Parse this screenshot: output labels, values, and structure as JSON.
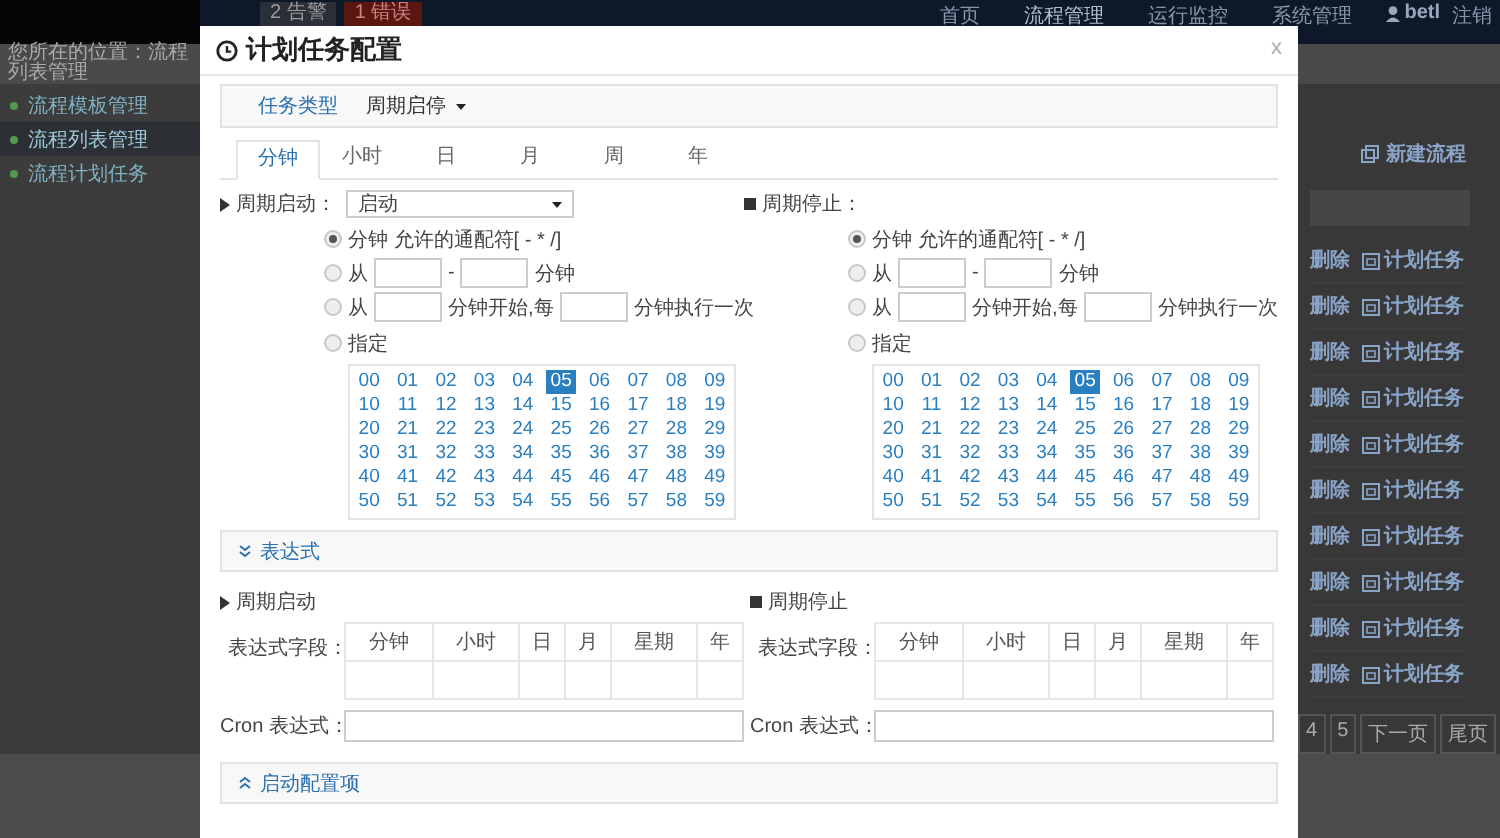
{
  "background": {
    "alerts": [
      {
        "label": "2 告警",
        "kind": "warning"
      },
      {
        "label": "1 错误",
        "kind": "error"
      }
    ],
    "nav": [
      {
        "label": "首页",
        "selected": false
      },
      {
        "label": "流程管理",
        "selected": true
      },
      {
        "label": "运行监控",
        "selected": false
      },
      {
        "label": "系统管理",
        "selected": false
      }
    ],
    "user": "betl",
    "logout": "注销",
    "breadcrumb": "您所在的位置：流程列表管理",
    "sidebar": [
      {
        "label": "流程模板管理",
        "selected": false
      },
      {
        "label": "流程列表管理",
        "selected": true
      },
      {
        "label": "流程计划任务",
        "selected": false
      }
    ],
    "new_button": "新建流程",
    "rows": [
      {
        "delete": "删除",
        "schedule": "计划任务"
      },
      {
        "delete": "删除",
        "schedule": "计划任务"
      },
      {
        "delete": "删除",
        "schedule": "计划任务"
      },
      {
        "delete": "删除",
        "schedule": "计划任务"
      },
      {
        "delete": "删除",
        "schedule": "计划任务"
      },
      {
        "delete": "删除",
        "schedule": "计划任务"
      },
      {
        "delete": "删除",
        "schedule": "计划任务"
      },
      {
        "delete": "删除",
        "schedule": "计划任务"
      },
      {
        "delete": "删除",
        "schedule": "计划任务"
      },
      {
        "delete": "删除",
        "schedule": "计划任务"
      }
    ],
    "pagination": [
      "4",
      "5",
      "下一页",
      "尾页"
    ]
  },
  "dialog": {
    "title": "计划任务配置",
    "close": "x",
    "task_type": {
      "label": "任务类型",
      "value": "周期启停"
    },
    "tabs": [
      {
        "label": "分钟",
        "selected": true
      },
      {
        "label": "小时",
        "selected": false
      },
      {
        "label": "日",
        "selected": false
      },
      {
        "label": "月",
        "selected": false
      },
      {
        "label": "周",
        "selected": false
      },
      {
        "label": "年",
        "selected": false
      }
    ],
    "start": {
      "kind": "start",
      "label": "周期启动：",
      "mode": "启动",
      "options": [
        {
          "kind": "wildcard",
          "selected": true,
          "text": "分钟 允许的通配符[ - * /]"
        },
        {
          "kind": "range",
          "selected": false,
          "from": "从",
          "dash": "-",
          "unit": "分钟"
        },
        {
          "kind": "step",
          "selected": false,
          "from": "从",
          "middle": "分钟开始,每",
          "unit": "分钟执行一次"
        },
        {
          "kind": "specify",
          "selected": false,
          "text": "指定",
          "minutes": [
            {
              "value": "00",
              "selected": false
            },
            {
              "value": "01",
              "selected": false
            },
            {
              "value": "02",
              "selected": false
            },
            {
              "value": "03",
              "selected": false
            },
            {
              "value": "04",
              "selected": false
            },
            {
              "value": "05",
              "selected": true
            },
            {
              "value": "06",
              "selected": false
            },
            {
              "value": "07",
              "selected": false
            },
            {
              "value": "08",
              "selected": false
            },
            {
              "value": "09",
              "selected": false
            },
            {
              "value": "10",
              "selected": false
            },
            {
              "value": "11",
              "selected": false
            },
            {
              "value": "12",
              "selected": false
            },
            {
              "value": "13",
              "selected": false
            },
            {
              "value": "14",
              "selected": false
            },
            {
              "value": "15",
              "selected": false
            },
            {
              "value": "16",
              "selected": false
            },
            {
              "value": "17",
              "selected": false
            },
            {
              "value": "18",
              "selected": false
            },
            {
              "value": "19",
              "selected": false
            },
            {
              "value": "20",
              "selected": false
            },
            {
              "value": "21",
              "selected": false
            },
            {
              "value": "22",
              "selected": false
            },
            {
              "value": "23",
              "selected": false
            },
            {
              "value": "24",
              "selected": false
            },
            {
              "value": "25",
              "selected": false
            },
            {
              "value": "26",
              "selected": false
            },
            {
              "value": "27",
              "selected": false
            },
            {
              "value": "28",
              "selected": false
            },
            {
              "value": "29",
              "selected": false
            },
            {
              "value": "30",
              "selected": false
            },
            {
              "value": "31",
              "selected": false
            },
            {
              "value": "32",
              "selected": false
            },
            {
              "value": "33",
              "selected": false
            },
            {
              "value": "34",
              "selected": false
            },
            {
              "value": "35",
              "selected": false
            },
            {
              "value": "36",
              "selected": false
            },
            {
              "value": "37",
              "selected": false
            },
            {
              "value": "38",
              "selected": false
            },
            {
              "value": "39",
              "selected": false
            },
            {
              "value": "40",
              "selected": false
            },
            {
              "value": "41",
              "selected": false
            },
            {
              "value": "42",
              "selected": false
            },
            {
              "value": "43",
              "selected": false
            },
            {
              "value": "44",
              "selected": false
            },
            {
              "value": "45",
              "selected": false
            },
            {
              "value": "46",
              "selected": false
            },
            {
              "value": "47",
              "selected": false
            },
            {
              "value": "48",
              "selected": false
            },
            {
              "value": "49",
              "selected": false
            },
            {
              "value": "50",
              "selected": false
            },
            {
              "value": "51",
              "selected": false
            },
            {
              "value": "52",
              "selected": false
            },
            {
              "value": "53",
              "selected": false
            },
            {
              "value": "54",
              "selected": false
            },
            {
              "value": "55",
              "selected": false
            },
            {
              "value": "56",
              "selected": false
            },
            {
              "value": "57",
              "selected": false
            },
            {
              "value": "58",
              "selected": false
            },
            {
              "value": "59",
              "selected": false
            }
          ]
        }
      ]
    },
    "stop": {
      "kind": "stop",
      "label": "周期停止：",
      "options": [
        {
          "kind": "wildcard",
          "selected": true,
          "text": "分钟 允许的通配符[ - * /]"
        },
        {
          "kind": "range",
          "selected": false,
          "from": "从",
          "dash": "-",
          "unit": "分钟"
        },
        {
          "kind": "step",
          "selected": false,
          "from": "从",
          "middle": "分钟开始,每",
          "unit": "分钟执行一次"
        },
        {
          "kind": "specify",
          "selected": false,
          "text": "指定",
          "minutes": [
            {
              "value": "00",
              "selected": false
            },
            {
              "value": "01",
              "selected": false
            },
            {
              "value": "02",
              "selected": false
            },
            {
              "value": "03",
              "selected": false
            },
            {
              "value": "04",
              "selected": false
            },
            {
              "value": "05",
              "selected": true
            },
            {
              "value": "06",
              "selected": false
            },
            {
              "value": "07",
              "selected": false
            },
            {
              "value": "08",
              "selected": false
            },
            {
              "value": "09",
              "selected": false
            },
            {
              "value": "10",
              "selected": false
            },
            {
              "value": "11",
              "selected": false
            },
            {
              "value": "12",
              "selected": false
            },
            {
              "value": "13",
              "selected": false
            },
            {
              "value": "14",
              "selected": false
            },
            {
              "value": "15",
              "selected": false
            },
            {
              "value": "16",
              "selected": false
            },
            {
              "value": "17",
              "selected": false
            },
            {
              "value": "18",
              "selected": false
            },
            {
              "value": "19",
              "selected": false
            },
            {
              "value": "20",
              "selected": false
            },
            {
              "value": "21",
              "selected": false
            },
            {
              "value": "22",
              "selected": false
            },
            {
              "value": "23",
              "selected": false
            },
            {
              "value": "24",
              "selected": false
            },
            {
              "value": "25",
              "selected": false
            },
            {
              "value": "26",
              "selected": false
            },
            {
              "value": "27",
              "selected": false
            },
            {
              "value": "28",
              "selected": false
            },
            {
              "value": "29",
              "selected": false
            },
            {
              "value": "30",
              "selected": false
            },
            {
              "value": "31",
              "selected": false
            },
            {
              "value": "32",
              "selected": false
            },
            {
              "value": "33",
              "selected": false
            },
            {
              "value": "34",
              "selected": false
            },
            {
              "value": "35",
              "selected": false
            },
            {
              "value": "36",
              "selected": false
            },
            {
              "value": "37",
              "selected": false
            },
            {
              "value": "38",
              "selected": false
            },
            {
              "value": "39",
              "selected": false
            },
            {
              "value": "40",
              "selected": false
            },
            {
              "value": "41",
              "selected": false
            },
            {
              "value": "42",
              "selected": false
            },
            {
              "value": "43",
              "selected": false
            },
            {
              "value": "44",
              "selected": false
            },
            {
              "value": "45",
              "selected": false
            },
            {
              "value": "46",
              "selected": false
            },
            {
              "value": "47",
              "selected": false
            },
            {
              "value": "48",
              "selected": false
            },
            {
              "value": "49",
              "selected": false
            },
            {
              "value": "50",
              "selected": false
            },
            {
              "value": "51",
              "selected": false
            },
            {
              "value": "52",
              "selected": false
            },
            {
              "value": "53",
              "selected": false
            },
            {
              "value": "54",
              "selected": false
            },
            {
              "value": "55",
              "selected": false
            },
            {
              "value": "56",
              "selected": false
            },
            {
              "value": "57",
              "selected": false
            },
            {
              "value": "58",
              "selected": false
            },
            {
              "value": "59",
              "selected": false
            }
          ]
        }
      ]
    },
    "expression_panel": {
      "label": "表达式",
      "expanded": true
    },
    "expressions": [
      {
        "kind": "start",
        "title": "周期启动",
        "field_label": "表达式字段：",
        "columns": [
          "分钟",
          "小时",
          "日",
          "月",
          "星期",
          "年"
        ],
        "cron_label": "Cron 表达式："
      },
      {
        "kind": "stop",
        "title": "周期停止",
        "field_label": "表达式字段：",
        "columns": [
          "分钟",
          "小时",
          "日",
          "月",
          "星期",
          "年"
        ],
        "cron_label": "Cron 表达式："
      }
    ],
    "config_panel": {
      "label": "启动配置项",
      "expanded": false
    }
  }
}
